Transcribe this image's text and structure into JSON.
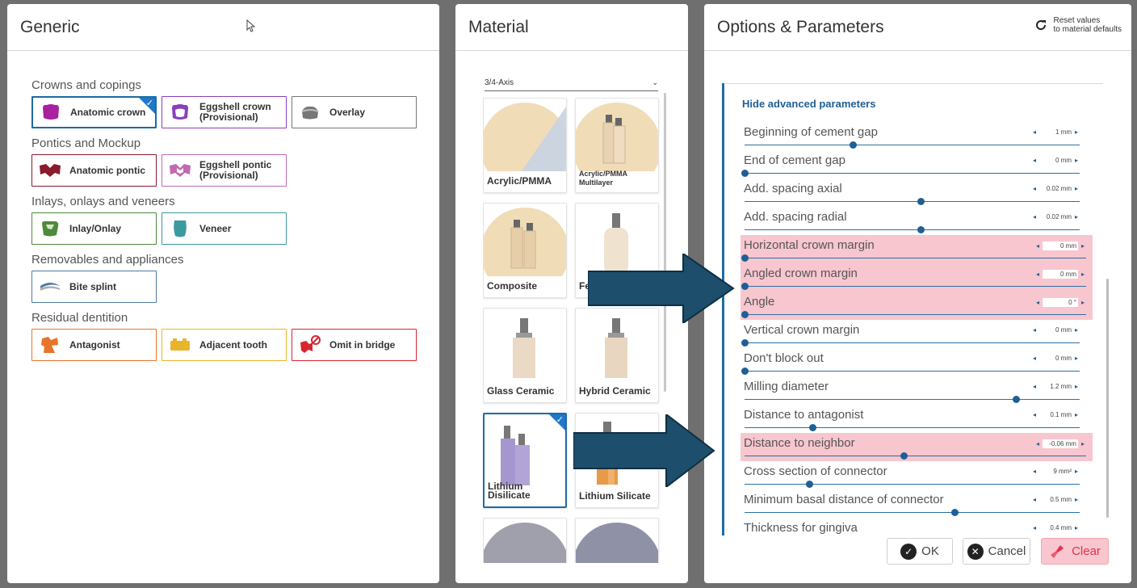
{
  "generic": {
    "title": "Generic",
    "groups": [
      {
        "title": "Crowns and copings",
        "items": [
          {
            "label": "Anatomic crown",
            "icon": "anatomic-crown-icon",
            "color": "#a8219f",
            "selected": true
          },
          {
            "label": "Eggshell crown (Provisional)",
            "icon": "eggshell-crown-icon",
            "color": "#8a3fc0",
            "selected": false
          },
          {
            "label": "Overlay",
            "icon": "overlay-icon",
            "color": "#777777",
            "selected": false
          }
        ]
      },
      {
        "title": "Pontics and Mockup",
        "items": [
          {
            "label": "Anatomic pontic",
            "icon": "anatomic-pontic-icon",
            "color": "#8b1a2b",
            "selected": false
          },
          {
            "label": "Eggshell pontic (Provisional)",
            "icon": "eggshell-pontic-icon",
            "color": "#c06ab0",
            "selected": false
          }
        ]
      },
      {
        "title": "Inlays, onlays and veneers",
        "items": [
          {
            "label": "Inlay/Onlay",
            "icon": "inlay-onlay-icon",
            "color": "#4f8a3c",
            "selected": false
          },
          {
            "label": "Veneer",
            "icon": "veneer-icon",
            "color": "#3a9aa0",
            "selected": false
          }
        ]
      },
      {
        "title": "Removables and appliances",
        "items": [
          {
            "label": "Bite splint",
            "icon": "bite-splint-icon",
            "color": "#4d7aa8",
            "selected": false
          }
        ]
      },
      {
        "title": "Residual dentition",
        "items": [
          {
            "label": "Antagonist",
            "icon": "antagonist-icon",
            "color": "#e8742a",
            "selected": false
          },
          {
            "label": "Adjacent tooth",
            "icon": "adjacent-tooth-icon",
            "color": "#e8b52a",
            "selected": false
          },
          {
            "label": "Omit in bridge",
            "icon": "omit-in-bridge-icon",
            "color": "#d8262f",
            "selected": false
          }
        ]
      }
    ]
  },
  "material": {
    "title": "Material",
    "selector_value": "3/4-Axis",
    "cards": [
      {
        "label": "Acrylic/PMMA",
        "small": false,
        "selected": false
      },
      {
        "label": "Acrylic/PMMA Multilayer",
        "small": true,
        "selected": false
      },
      {
        "label": "Composite",
        "small": false,
        "selected": false
      },
      {
        "label": "Fe",
        "small": false,
        "selected": false
      },
      {
        "label": "Glass Ceramic",
        "small": false,
        "selected": false
      },
      {
        "label": "Hybrid Ceramic",
        "small": false,
        "selected": false
      },
      {
        "label": "Lithium Disilicate",
        "small": false,
        "selected": true
      },
      {
        "label": "Lithium Silicate",
        "small": false,
        "selected": false
      },
      {
        "label": "",
        "small": false,
        "selected": false
      },
      {
        "label": "",
        "small": false,
        "selected": false
      }
    ]
  },
  "options": {
    "title": "Options & Parameters",
    "reset_label_1": "Reset values",
    "reset_label_2": "to material defaults",
    "hide_advanced": "Hide advanced parameters",
    "params": [
      {
        "label": "Beginning of cement gap",
        "value": "1 mm",
        "slider": 0.32,
        "highlight": false
      },
      {
        "label": "End of cement gap",
        "value": "0 mm",
        "slider": 0.0,
        "highlight": false
      },
      {
        "label": "Add. spacing axial",
        "value": "0.02 mm",
        "slider": 0.52,
        "highlight": false
      },
      {
        "label": "Add. spacing radial",
        "value": "0.02 mm",
        "slider": 0.52,
        "highlight": false
      },
      {
        "label": "Horizontal crown margin",
        "value": "0 mm",
        "slider": 0.0,
        "highlight": true
      },
      {
        "label": "Angled crown margin",
        "value": "0 mm",
        "slider": 0.0,
        "highlight": true
      },
      {
        "label": "Angle",
        "value": "0 °",
        "slider": 0.0,
        "highlight": true
      },
      {
        "label": "Vertical crown margin",
        "value": "0 mm",
        "slider": 0.0,
        "highlight": false
      },
      {
        "label": "Don't block out",
        "value": "0 mm",
        "slider": 0.0,
        "highlight": false
      },
      {
        "label": "Milling diameter",
        "value": "1.2 mm",
        "slider": 0.8,
        "highlight": false
      },
      {
        "label": "Distance to antagonist",
        "value": "0.1 mm",
        "slider": 0.2,
        "highlight": false
      },
      {
        "label": "Distance to neighbor",
        "value": "-0.06 mm",
        "slider": 0.47,
        "highlight": true
      },
      {
        "label": "Cross section of connector",
        "value": "9 mm²",
        "slider": 0.19,
        "highlight": false
      },
      {
        "label": "Minimum basal distance of connector",
        "value": "0.5 mm",
        "slider": 0.62,
        "highlight": false
      },
      {
        "label": "Thickness for gingiva",
        "value": "0.4 mm",
        "slider": 0.0,
        "highlight": false
      }
    ],
    "ok_label": "OK",
    "cancel_label": "Cancel",
    "clear_label": "Clear"
  },
  "annotation_arrow_color": "#1d4e6b"
}
